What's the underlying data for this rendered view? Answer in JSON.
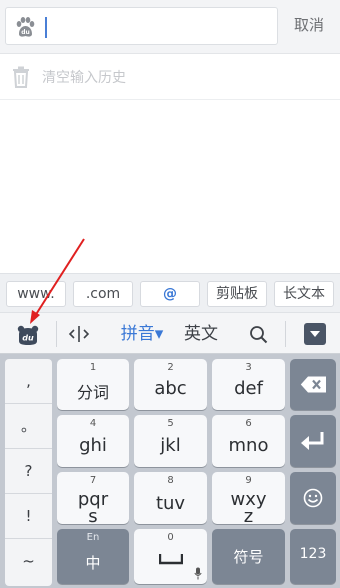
{
  "search": {
    "value": "",
    "cancel_label": "取消"
  },
  "history": {
    "clear_label": "清空输入历史"
  },
  "shortcuts": [
    "www.",
    ".com",
    "@",
    "剪贴板",
    "长文本"
  ],
  "toolbar": {
    "pinyin_label": "拼音▾",
    "english_label": "英文"
  },
  "symbols": [
    ",",
    "。",
    "?",
    "!",
    "~"
  ],
  "keys": {
    "k1": {
      "num": "1",
      "label": "分词"
    },
    "k2": {
      "num": "2",
      "label": "abc"
    },
    "k3": {
      "num": "3",
      "label": "def"
    },
    "k4": {
      "num": "4",
      "label": "ghi"
    },
    "k5": {
      "num": "5",
      "label": "jkl"
    },
    "k6": {
      "num": "6",
      "label": "mno"
    },
    "k7": {
      "num": "7",
      "label_top": "pqr",
      "label_bottom": "s"
    },
    "k8": {
      "num": "8",
      "label": "tuv"
    },
    "k9": {
      "num": "9",
      "label_top": "wxy",
      "label_bottom": "z"
    },
    "lang": {
      "top": "En",
      "label": "中"
    },
    "zero": {
      "num": "0"
    },
    "symbol_key": "符号",
    "num_key": "123"
  },
  "colors": {
    "accent": "#3a78d6",
    "arrow": "#e02020",
    "keyboard_bg": "#c3c8d0",
    "dark_key": "#7c8694"
  },
  "icons": [
    "baidu-paw-icon",
    "trash-icon",
    "cursor-move-icon",
    "search-icon",
    "collapse-keyboard-icon",
    "backspace-icon",
    "enter-icon",
    "emoji-icon",
    "space-icon",
    "mic-icon"
  ]
}
